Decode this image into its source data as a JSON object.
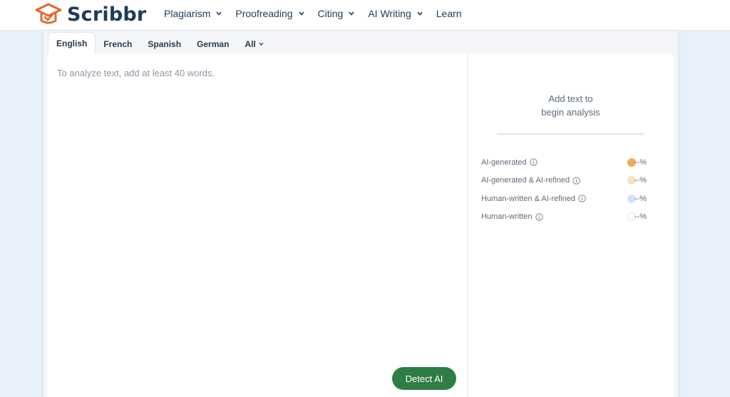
{
  "brand": {
    "name": "Scribbr",
    "accent": "#e3682f"
  },
  "nav": {
    "items": [
      {
        "label": "Plagiarism",
        "dropdown": true
      },
      {
        "label": "Proofreading",
        "dropdown": true
      },
      {
        "label": "Citing",
        "dropdown": true
      },
      {
        "label": "AI Writing",
        "dropdown": true
      },
      {
        "label": "Learn",
        "dropdown": false
      }
    ]
  },
  "tabs": {
    "items": [
      {
        "label": "English",
        "active": true
      },
      {
        "label": "French",
        "active": false
      },
      {
        "label": "Spanish",
        "active": false
      },
      {
        "label": "German",
        "active": false
      },
      {
        "label": "All",
        "active": false,
        "dropdown": true
      }
    ]
  },
  "editor": {
    "value": "",
    "placeholder": "To analyze text, add at least 40 words."
  },
  "detect_button": {
    "label": "Detect AI",
    "color": "#2f7d46"
  },
  "results": {
    "message_line1": "Add text to",
    "message_line2": "begin analysis",
    "legend": [
      {
        "label": "AI-generated",
        "value": "--%",
        "color": "#f2aa55",
        "icon": "info-icon"
      },
      {
        "label": "AI-generated & AI-refined",
        "value": "--%",
        "color": "#f8e3bf",
        "icon": "info-icon"
      },
      {
        "label": "Human-written & AI-refined",
        "value": "--%",
        "color": "#d3e2fb",
        "icon": "info-icon"
      },
      {
        "label": "Human-written",
        "value": "--%",
        "color": "#ffffff",
        "icon": "info-icon"
      }
    ]
  }
}
